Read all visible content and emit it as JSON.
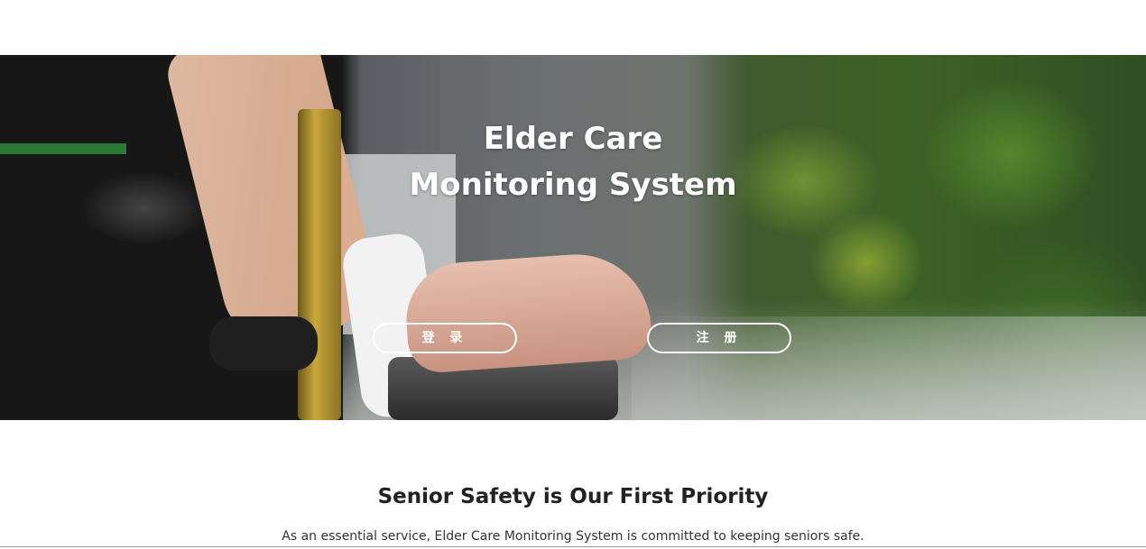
{
  "hero": {
    "title_line1": "Elder Care",
    "title_line2": "Monitoring System",
    "login_label": "登 录",
    "register_label": "注 册"
  },
  "section": {
    "title": "Senior Safety is Our First Priority",
    "subtitle": "As an essential service, Elder Care Monitoring System is committed to keeping seniors safe."
  },
  "colors": {
    "text_dark": "#222222",
    "button_border": "#ffffff"
  }
}
